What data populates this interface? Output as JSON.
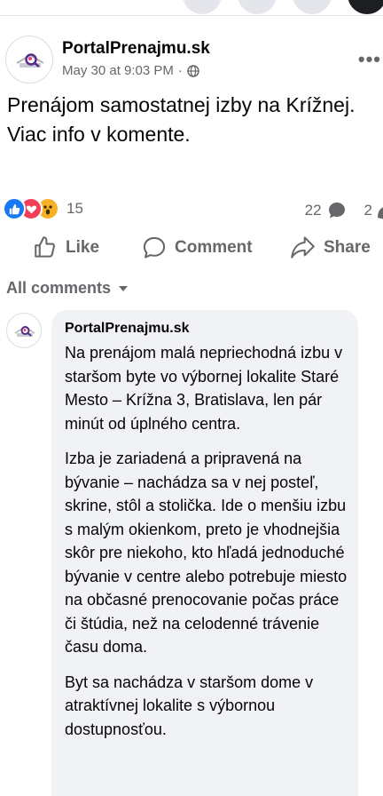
{
  "post": {
    "author": "PortalPrenajmu.sk",
    "timestamp": "May 30 at 9:03 PM",
    "audience_separator": "·",
    "text": "Prenájom samostatnej izby na Krížnej. Viac info v komente."
  },
  "reactions": {
    "total": "15",
    "types": [
      "like-icon",
      "love-icon",
      "wow-icon"
    ],
    "comments_count": "22",
    "shares_count": "2"
  },
  "actions": {
    "like": "Like",
    "comment": "Comment",
    "share": "Share"
  },
  "comments_filter": "All comments",
  "comment": {
    "author": "PortalPrenajmu.sk",
    "paragraphs": [
      "Na prenájom malá nepriechodná izbu v staršom byte vo výbornej lokalite Staré Mesto – Krížna 3, Bratislava, len pár minút od úplného centra.",
      "Izba je zariadená a pripravená na bývanie – nachádza sa v nej posteľ, skrine, stôl a stolička. Ide o menšiu izbu s malým okienkom, preto je vhodnejšia skôr pre niekoho, kto hľadá jednoduché bývanie v centre alebo potrebuje miesto na občasné prenocovanie počas práce či štúdia, než na celodenné trávenie času doma.",
      "Byt sa nachádza v staršom dome v atraktívnej lokalite s výbornou dostupnosťou."
    ]
  },
  "colors": {
    "like_blue": "#1877f2",
    "love_red": "#f33e58",
    "wow_yellow": "#f7b125",
    "secondary_text": "#65676b",
    "bubble_bg": "#f0f2f5"
  }
}
